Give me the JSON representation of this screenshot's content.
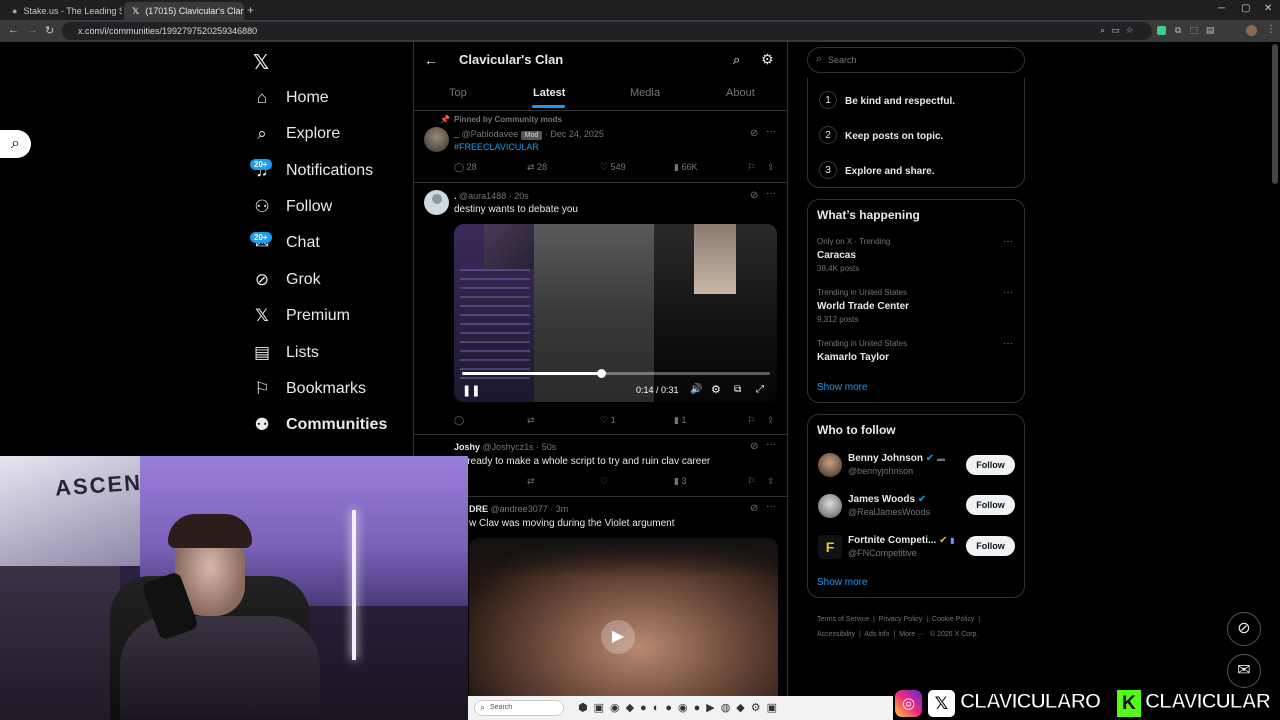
{
  "browser": {
    "tabs": [
      {
        "title": "Stake.us - The Leading Social C"
      },
      {
        "title": "(17015) Clavicular's Clan Co"
      }
    ],
    "url": "x.com/i/communities/1992797520259346880"
  },
  "nav": {
    "items": [
      {
        "label": "Home",
        "icon": "home-icon"
      },
      {
        "label": "Explore",
        "icon": "search-icon"
      },
      {
        "label": "Notifications",
        "icon": "bell-icon",
        "badge": "20+"
      },
      {
        "label": "Follow",
        "icon": "person-plus-icon"
      },
      {
        "label": "Chat",
        "icon": "mail-icon",
        "badge": "20+"
      },
      {
        "label": "Grok",
        "icon": "grok-icon"
      },
      {
        "label": "Premium",
        "icon": "x-logo-icon"
      },
      {
        "label": "Lists",
        "icon": "list-icon"
      },
      {
        "label": "Bookmarks",
        "icon": "bookmark-icon"
      },
      {
        "label": "Communities",
        "icon": "people-icon"
      }
    ]
  },
  "community": {
    "title": "Clavicular's Clan",
    "tabs": [
      "Top",
      "Latest",
      "Media",
      "About"
    ],
    "active_tab": "Latest"
  },
  "posts": [
    {
      "pinned_label": "Pinned by Community mods",
      "name": "_",
      "handle": "@Pablodavee",
      "mod_badge": "Mod",
      "time": "Dec 24, 2025",
      "text": "#FREECLAVICULAR",
      "replies": "28",
      "reposts": "28",
      "likes": "549",
      "views": "66K"
    },
    {
      "name": ".",
      "handle": "@aura1488",
      "time": "20s",
      "text": "destiny wants to debate you",
      "video_time": "0:14 / 0:31",
      "video_progress": 0.45,
      "replies": "",
      "reposts": "",
      "likes": "1",
      "views": "1"
    },
    {
      "name": "Joshy",
      "handle": "@Joshycz1s",
      "time": "50s",
      "text": "let ready to make a whole script to try and ruin clav career",
      "replies": "",
      "reposts": "",
      "likes": "",
      "views": "3"
    },
    {
      "name": "DRE",
      "handle": "@andree3077",
      "time": "3m",
      "text": "w Clav was moving during the Violet argument"
    }
  ],
  "sidebar": {
    "search_placeholder": "Search",
    "rules": [
      {
        "n": "1",
        "text": "Be kind and respectful."
      },
      {
        "n": "2",
        "text": "Keep posts on topic."
      },
      {
        "n": "3",
        "text": "Explore and share."
      }
    ],
    "happening": {
      "title": "What’s happening",
      "trends": [
        {
          "context": "Only on X · Trending",
          "name": "Caracas",
          "posts": "38.4K posts"
        },
        {
          "context": "Trending in United States",
          "name": "World Trade Center",
          "posts": "9,312 posts"
        },
        {
          "context": "Trending in United States",
          "name": "Kamarlo Taylor",
          "posts": ""
        }
      ],
      "show_more": "Show more"
    },
    "who_to_follow": {
      "title": "Who to follow",
      "users": [
        {
          "name": "Benny Johnson",
          "handle": "@bennyjohnson",
          "button": "Follow"
        },
        {
          "name": "James Woods",
          "handle": "@RealJamesWoods",
          "button": "Follow"
        },
        {
          "name": "Fortnite Competi...",
          "handle": "@FNCompetitive",
          "button": "Follow"
        }
      ],
      "show_more": "Show more"
    },
    "footer": {
      "links": [
        "Terms of Service",
        "Privacy Policy",
        "Cookie Policy",
        "Accessibility",
        "Ads info",
        "More ···"
      ],
      "copyright": "© 2026 X Corp."
    }
  },
  "overlay": {
    "social_handle": "CLAVICULARO",
    "kick_handle": "CLAVICULAR",
    "webcam_banner": "ASCEND"
  },
  "taskbar": {
    "search_placeholder": "Search"
  },
  "colors": {
    "accent": "#1d9bf0",
    "background": "#000000",
    "border": "#2f3336"
  }
}
